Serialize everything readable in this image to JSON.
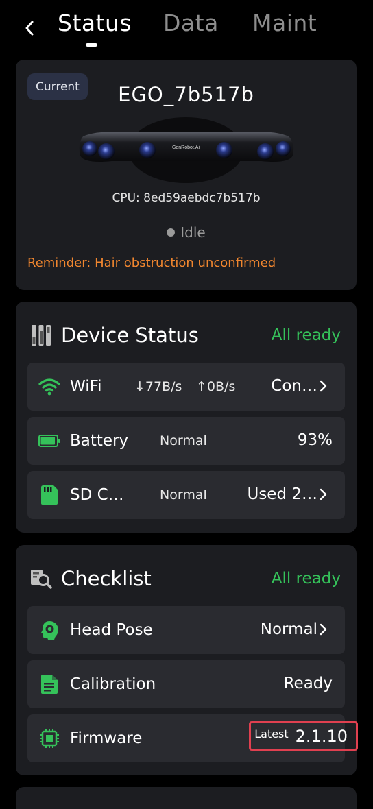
{
  "header": {
    "tabs": [
      {
        "label": "Status",
        "active": true
      },
      {
        "label": "Data",
        "active": false
      },
      {
        "label": "Maint",
        "active": false
      }
    ]
  },
  "device": {
    "badge": "Current",
    "name": "EGO_7b517b",
    "image_brand": "GenRobot.Ai",
    "cpu": "CPU: 8ed59aebdc7b517b",
    "state": "Idle",
    "reminder": "Reminder: Hair obstruction unconfirmed"
  },
  "device_status": {
    "title": "Device Status",
    "status": "All ready",
    "rows": {
      "wifi": {
        "label": "WiFi",
        "down": "77B/s",
        "up": "0B/s",
        "value": "Con…",
        "icon": "wifi-icon"
      },
      "battery": {
        "label": "Battery",
        "mid": "Normal",
        "value": "93%",
        "level": 0.93,
        "icon": "battery-icon"
      },
      "sd": {
        "label": "SD C…",
        "mid": "Normal",
        "value": "Used 2…",
        "icon": "sd-card-icon"
      }
    }
  },
  "checklist": {
    "title": "Checklist",
    "status": "All ready",
    "rows": {
      "head_pose": {
        "label": "Head Pose",
        "value": "Normal",
        "icon": "head-icon"
      },
      "calibration": {
        "label": "Calibration",
        "value": "Ready",
        "icon": "document-icon"
      },
      "firmware": {
        "label": "Firmware",
        "tag": "Latest",
        "version": "2.1.10",
        "icon": "chip-icon"
      }
    }
  },
  "colors": {
    "accent_green": "#35c25a",
    "warning_orange": "#f0862f",
    "highlight_red": "#e04050",
    "card_bg": "#1c1d21",
    "row_bg": "#2a2b30"
  }
}
